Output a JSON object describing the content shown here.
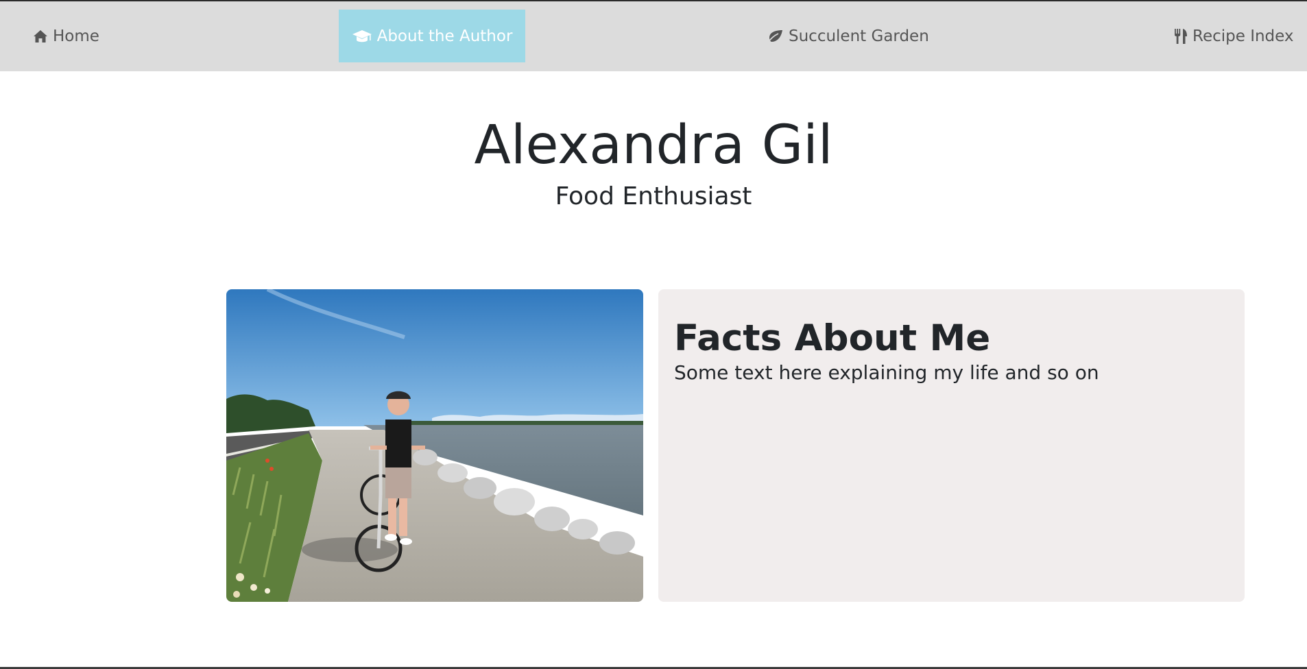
{
  "nav": {
    "items": [
      {
        "label": "Home",
        "icon": "home-icon"
      },
      {
        "label": "About the Author",
        "icon": "graduation-cap-icon",
        "active": true
      },
      {
        "label": "Succulent Garden",
        "icon": "leaf-icon"
      },
      {
        "label": "Recipe Index",
        "icon": "utensils-icon"
      }
    ],
    "active_color": "#9dd9e7",
    "bar_color": "#dcdcdc"
  },
  "header": {
    "name": "Alexandra Gil",
    "role": "Food Enthusiast"
  },
  "facts": {
    "title": "Facts About Me",
    "text": "Some text here explaining my life and so on",
    "card_color": "#f1eded"
  }
}
